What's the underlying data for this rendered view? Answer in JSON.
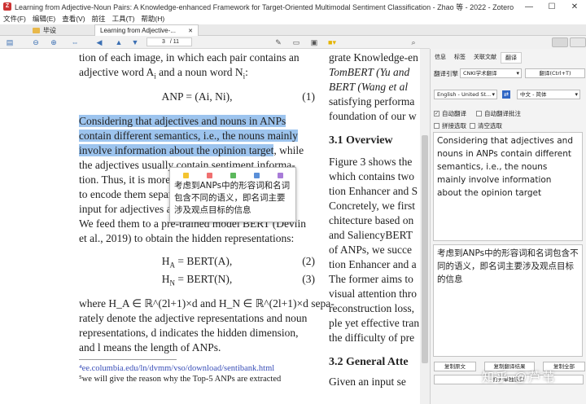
{
  "window": {
    "title": "Learning from Adjective-Noun Pairs: A Knowledge-enhanced Framework for Target-Oriented Multimodal Sentiment Classification - Zhao 等 - 2022 - Zotero",
    "app_icon_text": "Z",
    "minimize": "—",
    "maximize": "☐",
    "close": "✕"
  },
  "menu": [
    "文件(F)",
    "编辑(E)",
    "查看(V)",
    "前往",
    "工具(T)",
    "帮助(H)"
  ],
  "tabs": [
    {
      "label": "毕设"
    },
    {
      "label": "Learning from Adjective-...",
      "close": "✕"
    }
  ],
  "toolbar": {
    "page_current": "3",
    "page_total": "/ 11"
  },
  "pdf": {
    "left_lines": [
      {
        "text": "tion of each image, in which each pair contains an",
        "hl": false
      },
      {
        "text": "adjective word A",
        "suffix": "i",
        "rest": " and a noun word N",
        "suffix2": "i",
        "end": ":",
        "hl": false
      }
    ],
    "eq1": {
      "text": "ANP = (A",
      "tail": "i, N",
      "end": "i),",
      "num": "(1)"
    },
    "highlight_lines": [
      "Considering that adjectives and nouns in ANPs",
      "contain different semantics, i.e., the nouns mainly",
      "involve information about the opinion target"
    ],
    "highlight_tail": ", while",
    "body_lines": [
      "the adjectives usually contain sentiment informa-",
      "tion. Thus, it is more reasonable and feasible",
      "to encode them separately. We adopt BERT",
      "input for adjectives and nouns as in Figure 3.",
      "We feed them to a pre-trained model BERT (Devlin",
      "et al., 2019) to obtain the hidden representations:"
    ],
    "eq2": {
      "text": "H",
      "sub": "A",
      "rest": " = BERT(A),",
      "num": "(2)"
    },
    "eq3": {
      "text": "H",
      "sub": "N",
      "rest": " = BERT(N),",
      "num": "(3)"
    },
    "after_lines": [
      "where H_A ∈ ℝ^(2l+1)×d and H_N ∈ ℝ^(2l+1)×d sepa-",
      "rately denote the adjective representations and noun",
      "representations, d indicates the hidden dimension,",
      "and l means the length of ANPs."
    ],
    "footnotes": [
      "⁴ee.columbia.edu/ln/dvmm/vso/download/sentibank.html",
      "⁵we will give the reason why the Top-5 ANPs are extracted"
    ],
    "right_lines": [
      "grate Knowledge-en",
      "TomBERT (Yu and",
      "BERT (Wang et al",
      "satisfying performa",
      "foundation of our w"
    ],
    "section_31": "3.1   Overview",
    "right_lines2": [
      "Figure 3 shows the",
      "which contains two",
      "tion Enhancer and S",
      "Concretely, we first",
      "chitecture based on",
      "and SaliencyBERT",
      "of ANPs, we succe",
      "tion Enhancer and a",
      "The former aims to",
      "visual attention thro",
      "reconstruction loss,",
      "ple yet effective tran",
      "the difficulty of pre"
    ],
    "section_32": "3.2   General Atte",
    "right_lines3": [
      "Given an input se"
    ]
  },
  "popup": {
    "colors": [
      "#f4c430",
      "#f07070",
      "#5cb85c",
      "#5a8fd8",
      "#a87cd8"
    ],
    "text": "考虑到ANPs中的形容词和名词包含不同的语义，即名词主要涉及观点目标的信息"
  },
  "side": {
    "tabs": [
      "信息",
      "标签",
      "关联文献",
      "翻译"
    ],
    "active_tab": "翻译",
    "engine_label": "翻译引擎",
    "engine_value": "CNKI学术翻译",
    "translate_btn": "翻译(Ctrl+T)",
    "source_lang": "English - United St...",
    "swap_glyph": "⇄",
    "target_lang": "中文 - 简体",
    "options": [
      "自动翻译",
      "自动翻译批注",
      "拼接选取",
      "清空选取"
    ],
    "source_text": "Considering that adjectives and nouns in ANPs contain different semantics, i.e., the nouns mainly involve information about the opinion target",
    "result_text": "考虑到ANPs中的形容词和名词包含不同的语义，即名词主要涉及观点目标的信息",
    "copy_source": "复制原文",
    "copy_result": "复制翻译结果",
    "copy_all": "复制全部",
    "open_window": "打开单独窗口"
  },
  "watermark": "知乎 @芦苇"
}
